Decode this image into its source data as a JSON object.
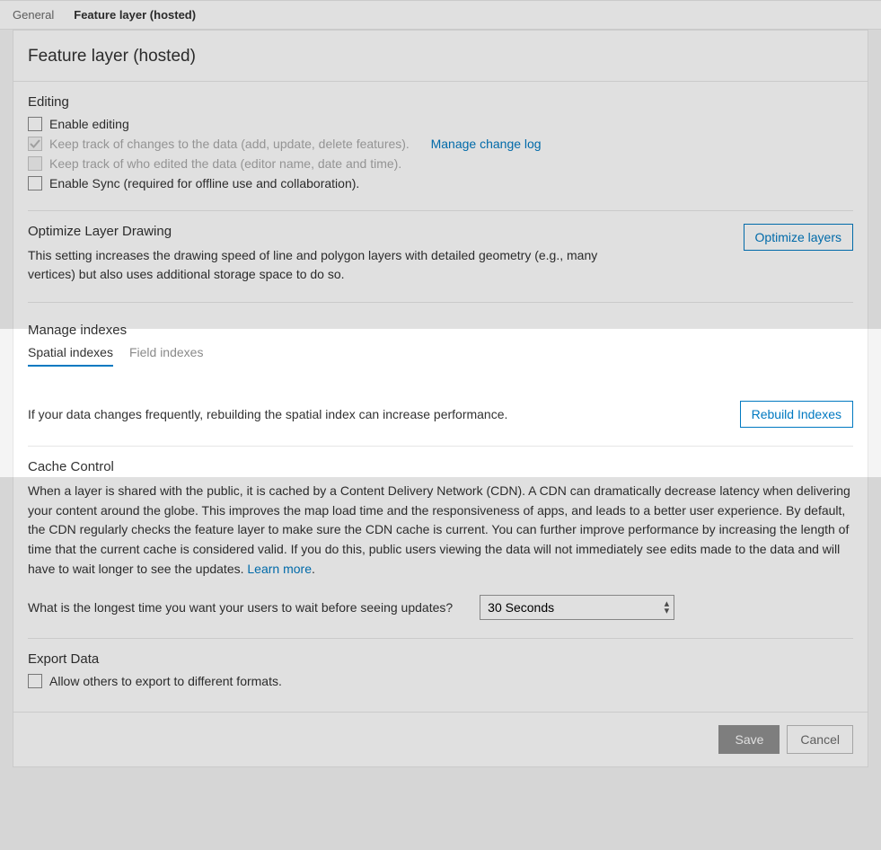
{
  "tabs": {
    "general": "General",
    "feature": "Feature layer (hosted)"
  },
  "panel": {
    "title": "Feature layer (hosted)"
  },
  "editing": {
    "title": "Editing",
    "enable": "Enable editing",
    "track_changes": "Keep track of changes to the data (add, update, delete features).",
    "manage_change_log": "Manage change log",
    "track_who": "Keep track of who edited the data (editor name, date and time).",
    "enable_sync": "Enable Sync (required for offline use and collaboration)."
  },
  "optimize": {
    "title": "Optimize Layer Drawing",
    "desc": "This setting increases the drawing speed of line and polygon layers with detailed geometry (e.g., many vertices) but also uses additional storage space to do so.",
    "button": "Optimize layers"
  },
  "indexes": {
    "title": "Manage indexes",
    "tab_spatial": "Spatial indexes",
    "tab_field": "Field indexes",
    "desc": "If your data changes frequently, rebuilding the spatial index can increase performance.",
    "button": "Rebuild Indexes"
  },
  "cache": {
    "title": "Cache Control",
    "desc": "When a layer is shared with the public, it is cached by a Content Delivery Network (CDN). A CDN can dramatically decrease latency when delivering your content around the globe. This improves the map load time and the responsiveness of apps, and leads to a better user experience. By default, the CDN regularly checks the feature layer to make sure the CDN cache is current. You can further improve performance by increasing the length of time that the current cache is considered valid. If you do this, public users viewing the data will not immediately see edits made to the data and will have to wait longer to see the updates. ",
    "learn_more": "Learn more",
    "period": ".",
    "question": "What is the longest time you want your users to wait before seeing updates?",
    "selected": "30 Seconds"
  },
  "export": {
    "title": "Export Data",
    "allow": "Allow others to export to different formats."
  },
  "footer": {
    "save": "Save",
    "cancel": "Cancel"
  }
}
